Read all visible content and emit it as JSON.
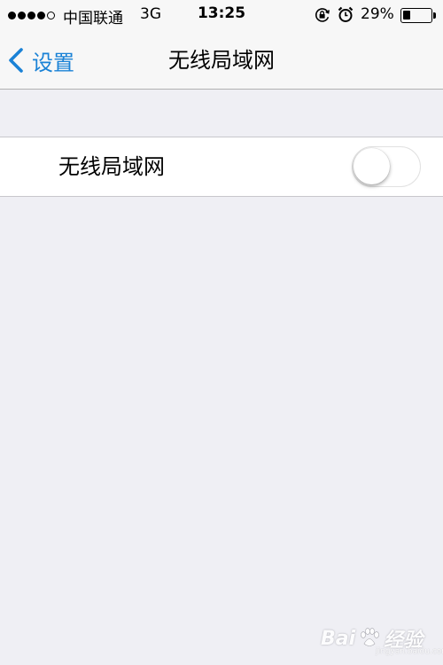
{
  "status_bar": {
    "signal_bars_filled": 4,
    "signal_bars_total": 5,
    "carrier": "中国联通",
    "network_type": "3G",
    "time": "13:25",
    "battery_percent": "29%",
    "battery_level": 0.29,
    "icons": [
      "orientation-lock-icon",
      "alarm-icon",
      "battery-icon"
    ]
  },
  "nav": {
    "back_label": "设置",
    "title": "无线局域网"
  },
  "wifi_cell": {
    "label": "无线局域网",
    "toggle_on": false
  },
  "watermark": {
    "brand": "Bai",
    "brand_suffix": "经验",
    "url": "jingyan.baidu.com"
  },
  "colors": {
    "accent": "#1a82d6",
    "background": "#efeff4",
    "bar": "#f7f7f7"
  }
}
